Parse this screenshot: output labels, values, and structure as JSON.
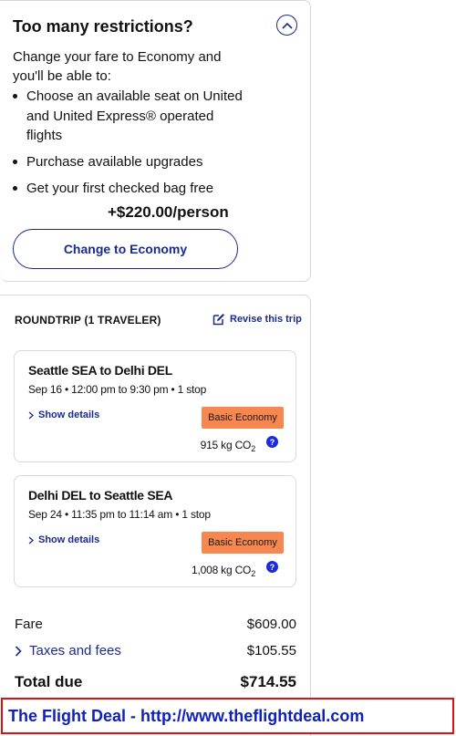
{
  "upsell": {
    "title": "Too many restrictions?",
    "intro": "Change your fare to Economy and you'll be able to:",
    "benefits": [
      "Choose an available seat on United and United Express® operated flights",
      "Purchase available upgrades",
      "Get your first checked bag free"
    ],
    "price": "+$220.00/person",
    "button_label": "Change to Economy",
    "collapse_icon": "chevron-up-icon"
  },
  "trip": {
    "header": "ROUNDTRIP (1 TRAVELER)",
    "revise_label": "Revise this trip",
    "segments": [
      {
        "route": "Seattle SEA to Delhi DEL",
        "times": "Sep 16 • 12:00 pm to 9:30 pm • 1 stop",
        "details_label": "Show details",
        "fare_class": "Basic Economy",
        "co2_value": "915 kg CO",
        "co2_sub": "2"
      },
      {
        "route": "Delhi DEL to Seattle SEA",
        "times": "Sep 24 • 11:35 pm to 11:14 am • 1 stop",
        "details_label": "Show details",
        "fare_class": "Basic Economy",
        "co2_value": "1,008 kg CO",
        "co2_sub": "2"
      }
    ],
    "help_icon_text": "?",
    "fare_label": "Fare",
    "fare_value": "$609.00",
    "taxes_label": "Taxes and fees",
    "taxes_value": "$105.55",
    "total_label": "Total due",
    "total_value": "$714.55"
  },
  "banner": {
    "text": "The Flight Deal - http://www.theflightdeal.com"
  },
  "colors": {
    "brand_blue": "#1a2a8c",
    "badge_orange": "#f5874f",
    "help_blue": "#1a2adf",
    "banner_border": "#e01010",
    "banner_text": "#1020c0"
  }
}
